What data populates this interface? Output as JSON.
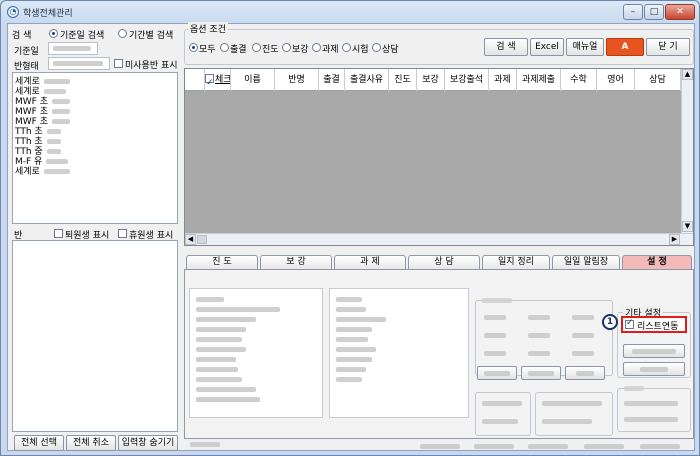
{
  "window": {
    "title": "학생전체관리",
    "min_glyph": "–",
    "max_glyph": "□",
    "close_glyph": "✕"
  },
  "search": {
    "label": "검 색",
    "mode_options": [
      "기준일 검색",
      "기간별 검색"
    ],
    "date_label": "기준일",
    "class_type_label": "반형태",
    "unused_class_label": "미사용반 표시"
  },
  "class_list": [
    "세계로",
    "세계로",
    "MWF 초",
    "MWF 초",
    "MWF 초",
    "TTh 초",
    "TTh 초",
    "TTh 중",
    "M-F 유",
    "세계로"
  ],
  "student_section": {
    "label": "반",
    "withdrawn_label": "퇴원생 표시",
    "leave_label": "휴원생 표시"
  },
  "bottom_buttons": [
    "전체 선택",
    "전체 취소",
    "입력창 숨기기"
  ],
  "options": {
    "label": "옵션 조건",
    "items": [
      "모두",
      "출결",
      "진도",
      "보강",
      "과제",
      "시험",
      "상담"
    ]
  },
  "toolbar": [
    "검 색",
    "Excel",
    "매뉴얼",
    "A",
    "닫 기"
  ],
  "grid": {
    "columns": [
      "체크",
      "이름",
      "반명",
      "출결",
      "출결사유",
      "진도",
      "보강",
      "보강출석",
      "과제",
      "과제제출",
      "수학",
      "영어",
      "상담"
    ]
  },
  "tabs": [
    "진 도",
    "보 강",
    "과 제",
    "상 담",
    "일지 정리",
    "일일 알림장",
    "설 정"
  ],
  "settings": {
    "group_title": "기타 설정",
    "list_link_label": "리스트연동",
    "marker": "1"
  },
  "colors": {
    "accent_red": "#e01b1b",
    "active_tab": "#f4b9b9",
    "grid_bg": "#a9a9a9",
    "title_bg": "#d3e1f3"
  }
}
